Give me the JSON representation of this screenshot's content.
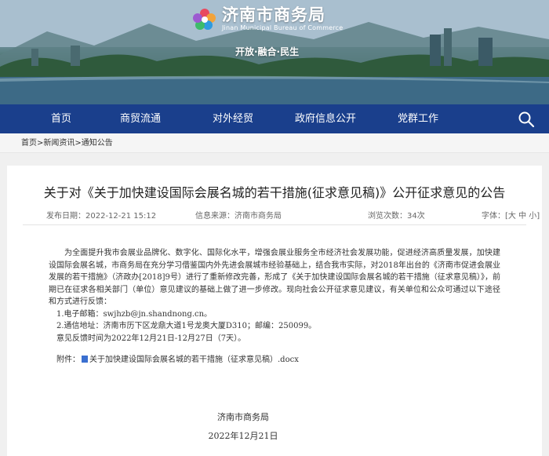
{
  "header": {
    "logo_cn": "济南市商务局",
    "logo_en": "Jinan Municipal Bureau of Commerce",
    "slogan": "开放·融合·民生"
  },
  "nav": {
    "items": [
      "首页",
      "商贸流通",
      "对外经贸",
      "政府信息公开",
      "党群工作"
    ],
    "search_icon": "search-icon"
  },
  "breadcrumb": [
    "首页",
    "新闻资讯",
    "通知公告"
  ],
  "breadcrumb_sep": ">",
  "article": {
    "title": "关于对《关于加快建设国际会展名城的若干措施(征求意见稿)》公开征求意见的公告",
    "publish_label": "发布日期：2022-12-21 15:12",
    "source_label": "信息来源：济南市商务局",
    "views_label": "浏览次数：34次",
    "font_size_label": "字体：",
    "font_sizes": "[大 中 小]",
    "paragraph": "为全面提升我市会展业品牌化、数字化、国际化水平，增强会展业服务全市经济社会发展功能，促进经济高质量发展，加快建设国际会展名城，市商务局在充分学习借鉴国内外先进会展城市经验基础上，结合我市实际，对2018年出台的《济南市促进会展业发展的若干措施》（济政办[2018]9号）进行了重新修改完善，形成了《关于加快建设国际会展名城的若干措施（征求意见稿）》，前期已在征求各相关部门（单位）意见建议的基础上做了进一步修改。现向社会公开征求意见建议，有关单位和公众可通过以下途径和方式进行反馈：",
    "item1": "1.电子邮箱：swjhzb@jn.shandnong.cn。",
    "item2": "2.通信地址：济南市历下区龙鼎大道1号龙奥大厦D310；邮编：250099。",
    "deadline": "意见反馈时间为2022年12月21日-12月27日（7天）。",
    "attachment_label": "附件：",
    "attachment_name": "关于加快建设国际会展名城的若干措施（征求意见稿）.docx",
    "signature_org": "济南市商务局",
    "signature_date": "2022年12月21日"
  },
  "colors": {
    "nav_bg": "#1a3f8c",
    "attachment_icon": "#3a6fd0"
  }
}
